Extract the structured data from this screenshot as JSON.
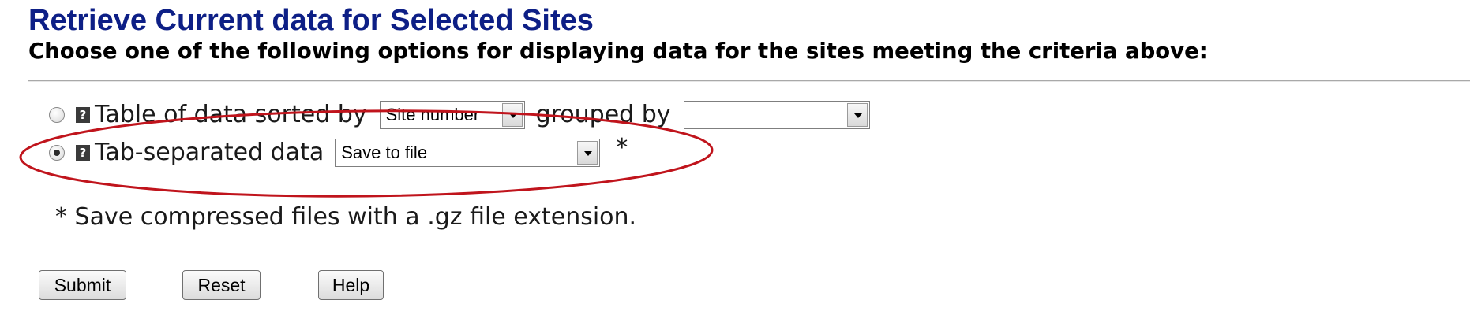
{
  "header": {
    "title": "Retrieve Current data for Selected Sites",
    "subtitle": "Choose one of the following options for displaying data for the sites meeting the criteria above:"
  },
  "options": {
    "table": {
      "label": "Table of data sorted by",
      "checked": false,
      "sort_select_value": "Site number",
      "grouped_label": "grouped by",
      "group_select_value": ""
    },
    "tsv": {
      "label": "Tab-separated data",
      "checked": true,
      "output_select_value": "Save to file",
      "asterisk": "*"
    }
  },
  "help_icon_glyph": "?",
  "footnote": "* Save compressed files with a .gz file extension.",
  "buttons": {
    "submit": "Submit",
    "reset": "Reset",
    "help": "Help"
  },
  "colors": {
    "title": "#0d1f86",
    "highlight": "#c0141c"
  },
  "icons": {
    "help": "help-question-icon",
    "dropdown": "chevron-down-icon"
  }
}
